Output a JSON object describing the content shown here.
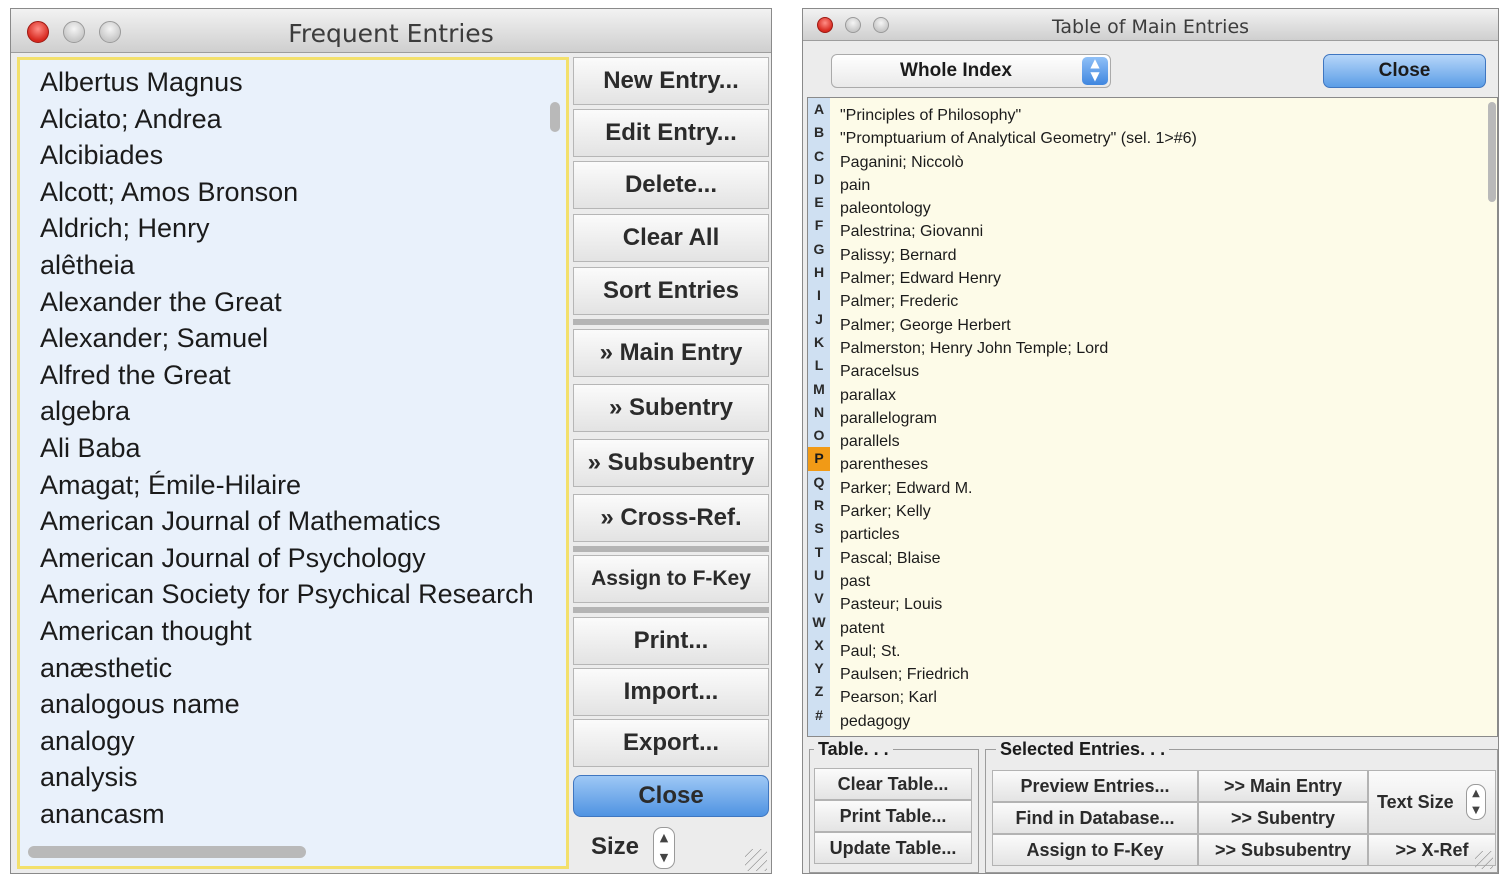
{
  "frequent": {
    "title": "Frequent Entries",
    "entries": [
      "Albertus Magnus",
      "Alciato; Andrea",
      "Alcibiades",
      "Alcott; Amos Bronson",
      "Aldrich; Henry",
      "alêtheia",
      "Alexander the Great",
      "Alexander; Samuel",
      "Alfred the Great",
      "algebra",
      "Ali Baba",
      "Amagat; Émile-Hilaire",
      "American Journal of Mathematics",
      "American Journal of Psychology",
      "American Society for Psychical Research",
      "American thought",
      "anæsthetic",
      "analogous name",
      "analogy",
      "analysis",
      "anancasm"
    ],
    "buttons": {
      "new_entry": "New Entry...",
      "edit_entry": "Edit Entry...",
      "delete": "Delete...",
      "clear_all": "Clear All",
      "sort_entries": "Sort Entries",
      "main_entry": "» Main Entry",
      "subentry": "» Subentry",
      "subsubentry": "» Subsubentry",
      "cross_ref": "» Cross-Ref.",
      "assign_fkey": "Assign to F-Key",
      "print": "Print...",
      "import": "Import...",
      "export": "Export...",
      "close": "Close"
    },
    "size_label": "Size",
    "accent_color": "#f3e06b"
  },
  "table": {
    "title": "Table of Main Entries",
    "scope_select": "Whole Index",
    "close_label": "Close",
    "letters": [
      "A",
      "B",
      "C",
      "D",
      "E",
      "F",
      "G",
      "H",
      "I",
      "J",
      "K",
      "L",
      "M",
      "N",
      "O",
      "P",
      "Q",
      "R",
      "S",
      "T",
      "U",
      "V",
      "W",
      "X",
      "Y",
      "Z",
      "#"
    ],
    "selected_letter": "P",
    "entries": [
      "\"Principles of Philosophy\"",
      "\"Promptuarium of Analytical Geometry\" (sel. 1>#6)",
      "Paganini; Niccolò",
      "pain",
      "paleontology",
      "Palestrina; Giovanni",
      "Palissy; Bernard",
      "Palmer; Edward Henry",
      "Palmer; Frederic",
      "Palmer; George Herbert",
      "Palmerston; Henry John Temple; Lord",
      "Paracelsus",
      "parallax",
      "parallelogram",
      "parallels",
      "parentheses",
      "Parker; Edward M.",
      "Parker; Kelly",
      "particles",
      "Pascal; Blaise",
      "past",
      "Pasteur; Louis",
      "patent",
      "Paul; St.",
      "Paulsen; Friedrich",
      "Pearson; Karl",
      "pedagogy"
    ],
    "table_group": {
      "legend": "Table. . .",
      "clear": "Clear Table...",
      "print": "Print Table...",
      "update": "Update Table..."
    },
    "selected_group": {
      "legend": "Selected Entries. . .",
      "preview": "Preview Entries...",
      "find": "Find in Database...",
      "assign": "Assign to F-Key",
      "main_entry": ">> Main Entry",
      "subentry": ">> Subentry",
      "subsubentry": ">> Subsubentry",
      "text_size": "Text Size",
      "xref": ">> X-Ref"
    },
    "selected_letter_color": "#f19a16"
  }
}
